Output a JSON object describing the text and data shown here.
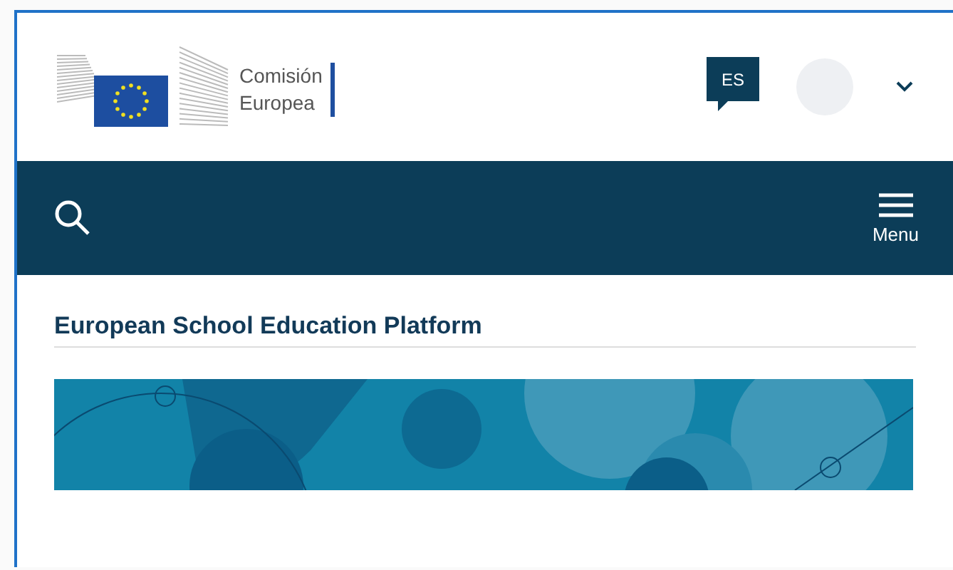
{
  "header": {
    "logo_lines": [
      "Comisión",
      "Europea"
    ],
    "language": "ES"
  },
  "nav_bar": {
    "menu_label": "Menu"
  },
  "page_title": "European School Education Platform"
}
